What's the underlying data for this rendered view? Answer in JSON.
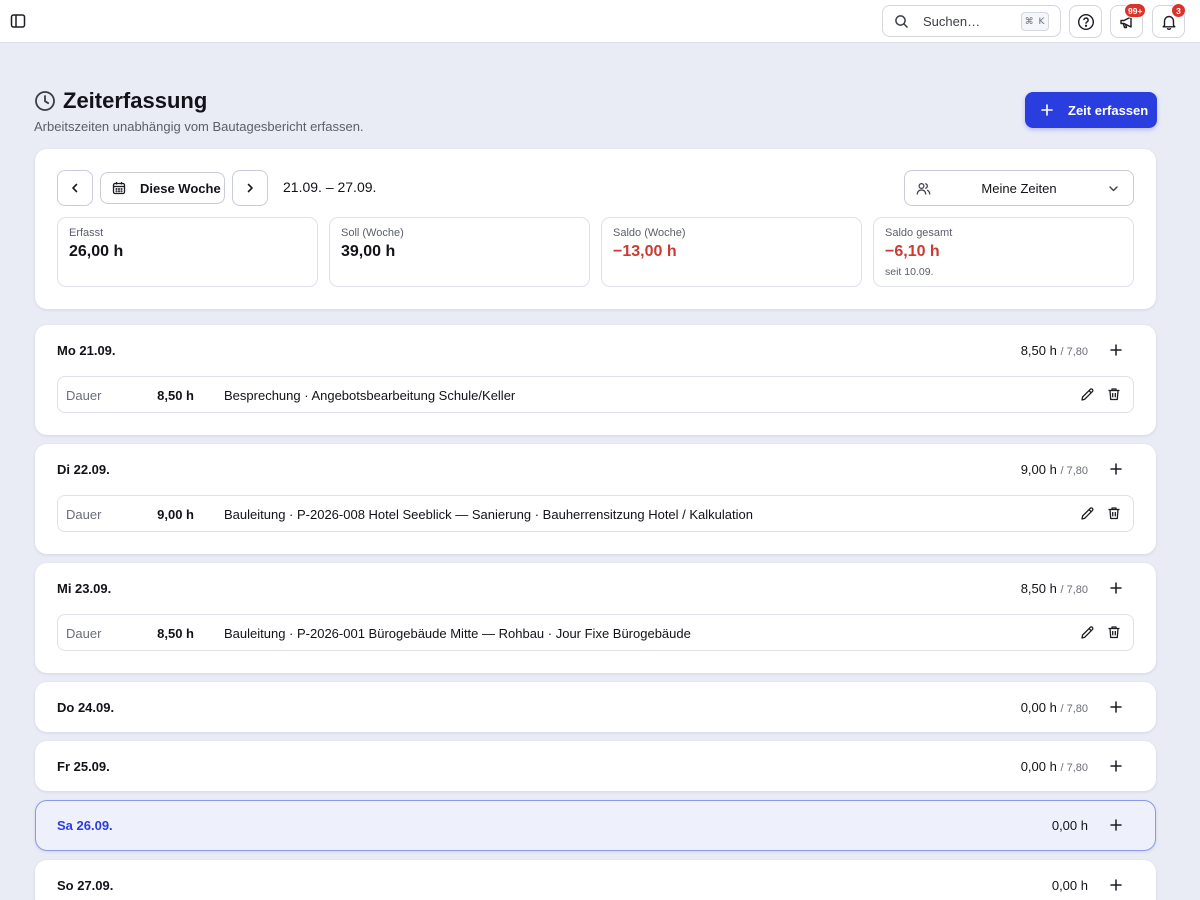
{
  "topbar": {
    "search_placeholder": "Suchen…",
    "search_shortcut": "⌘ K",
    "announcements_badge": "99+",
    "notifications_badge": "3"
  },
  "header": {
    "title": "Zeiterfassung",
    "subtitle": "Arbeitszeiten unabhängig vom Bautagesbericht erfassen.",
    "primary_action": "Zeit erfassen"
  },
  "week": {
    "this_week_label": "Diese Woche",
    "range": "21.09. – 27.09.",
    "scope": "Meine Zeiten"
  },
  "stats": [
    {
      "label": "Erfasst",
      "value": "26,00 h",
      "note": ""
    },
    {
      "label": "Soll (Woche)",
      "value": "39,00 h",
      "note": ""
    },
    {
      "label": "Saldo (Woche)",
      "value": "−13,00 h",
      "note": ""
    },
    {
      "label": "Saldo gesamt",
      "value": "−6,10 h",
      "note": "seit 10.09."
    }
  ],
  "days": [
    {
      "label": "Mo 21.09.",
      "hours": "8,50 h",
      "target": "/ 7,80",
      "entry": {
        "duration_label": "Dauer",
        "duration": "8,50 h",
        "description": "Besprechung · Angebotsbearbeitung Schule/Keller"
      }
    },
    {
      "label": "Di 22.09.",
      "hours": "9,00 h",
      "target": "/ 7,80",
      "entry": {
        "duration_label": "Dauer",
        "duration": "9,00 h",
        "description": "Bauleitung · P-2026-008 Hotel Seeblick — Sanierung · Bauherrensitzung Hotel / Kalkulation"
      }
    },
    {
      "label": "Mi 23.09.",
      "hours": "8,50 h",
      "target": "/ 7,80",
      "entry": {
        "duration_label": "Dauer",
        "duration": "8,50 h",
        "description": "Bauleitung · P-2026-001 Bürogebäude Mitte — Rohbau · Jour Fixe Bürogebäude"
      }
    },
    {
      "label": "Do 24.09.",
      "hours": "0,00 h",
      "target": "/ 7,80"
    },
    {
      "label": "Fr 25.09.",
      "hours": "0,00 h",
      "target": "/ 7,80"
    },
    {
      "label": "Sa 26.09.",
      "hours": "0,00 h",
      "target": ""
    },
    {
      "label": "So 27.09.",
      "hours": "0,00 h",
      "target": ""
    }
  ],
  "colors": {
    "accent": "#2a3ee0",
    "negative": "#cc3a32",
    "badge": "#d9332c",
    "background": "#e9ebf5"
  }
}
